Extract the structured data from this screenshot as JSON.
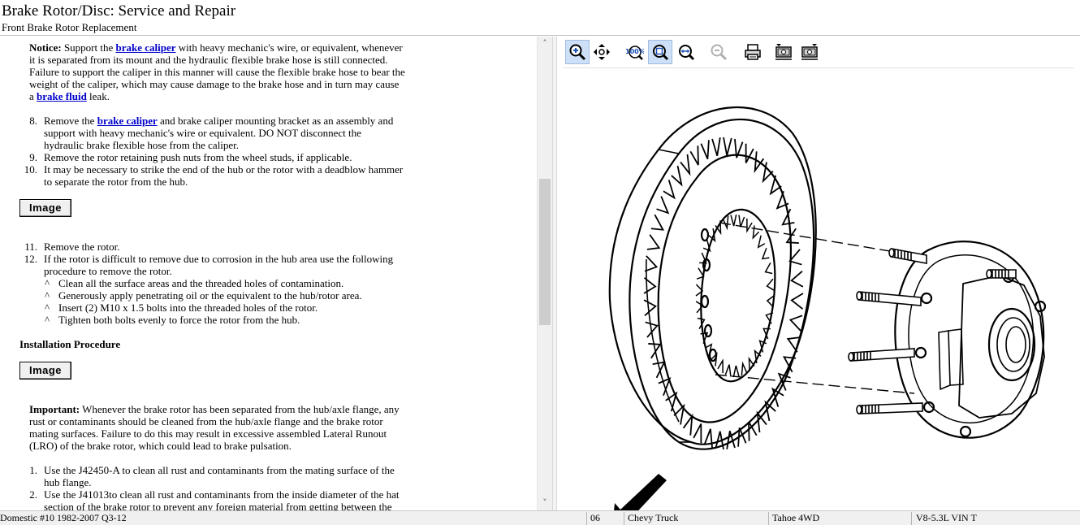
{
  "header": {
    "title": "Brake Rotor/Disc:  Service and Repair",
    "subtitle": "Front Brake Rotor Replacement"
  },
  "content": {
    "notice": {
      "label": "Notice:",
      "line1_pre": " Support the ",
      "line1_link": "brake caliper",
      "line1_post": " with heavy mechanic's wire, or equivalent, whenever",
      "line2": "it is separated from its mount and the hydraulic flexible brake hose is still connected.",
      "line3": "Failure to support the caliper in this manner will cause the flexible brake hose to bear the",
      "line4": "weight of the caliper, which may cause damage to the brake hose and in turn may cause",
      "line5_pre": "a ",
      "line5_link": "brake fluid",
      "line5_post": " leak."
    },
    "steps_a": [
      {
        "num": "8.",
        "l1_pre": "Remove the ",
        "l1_link": "brake caliper",
        "l1_post": " and brake caliper mounting bracket as an assembly and",
        "l2": "support with heavy mechanic's wire or equivalent. DO NOT disconnect the",
        "l3": "hydraulic brake flexible hose from the caliper."
      },
      {
        "num": "9.",
        "l1": "Remove the rotor retaining push nuts from the wheel studs, if applicable."
      },
      {
        "num": "10.",
        "l1": "It may be necessary to strike the end of the hub or the rotor with a deadblow hammer",
        "l2": "to separate the rotor from the hub."
      }
    ],
    "image_button_label": "Image",
    "steps_b": [
      {
        "num": "11.",
        "l1": "Remove the rotor."
      },
      {
        "num": "12.",
        "l1": "If the rotor is difficult to remove due to corrosion in the hub area use the following",
        "l2": "procedure to remove the rotor."
      }
    ],
    "substeps": [
      {
        "bullet": "^",
        "text": "Clean all the surface areas and the threaded holes of contamination."
      },
      {
        "bullet": "^",
        "text": "Generously apply penetrating oil or the equivalent to the hub/rotor area."
      },
      {
        "bullet": "^",
        "text": "Insert (2) M10 x 1.5 bolts into the threaded holes of the rotor."
      },
      {
        "bullet": "^",
        "text": "Tighten both bolts evenly to force the rotor from the hub."
      }
    ],
    "installation_heading": "Installation Procedure",
    "important": {
      "label": "Important:",
      "line1": " Whenever the brake rotor has been separated from the hub/axle flange, any",
      "line2": "rust or contaminants should be cleaned from the hub/axle flange and the brake rotor",
      "line3": "mating surfaces. Failure to do this may result in excessive assembled Lateral Runout",
      "line4": "(LRO) of the brake rotor, which could lead to brake pulsation."
    },
    "steps_c": [
      {
        "num": "1.",
        "l1": "Use the J42450-A to clean all rust and contaminants from the mating surface of the",
        "l2": "hub flange."
      },
      {
        "num": "2.",
        "l1": "Use the J41013to clean all rust and contaminants from the inside diameter of the hat",
        "l2": "section of the brake rotor to prevent any foreign material from getting between the"
      }
    ]
  },
  "scrollbar": {
    "up_icon": "chevron-up-icon",
    "down_icon": "chevron-down-icon",
    "up_glyph": "˄",
    "down_glyph": "˅"
  },
  "toolbar": {
    "buttons": [
      {
        "name": "zoom-in-icon",
        "active": true
      },
      {
        "name": "pan-move-icon",
        "active": false
      },
      {
        "name": "zoom-100-icon",
        "active": false
      },
      {
        "name": "zoom-fit-icon",
        "active": true
      },
      {
        "name": "zoom-width-icon",
        "active": false
      },
      {
        "name": "zoom-out-icon",
        "active": false,
        "disabled": true
      },
      {
        "name": "print-icon",
        "active": false
      },
      {
        "name": "rotate-left-icon",
        "active": false
      },
      {
        "name": "rotate-right-icon",
        "active": false
      }
    ],
    "zoom100_label": "100%"
  },
  "status": {
    "left": "Domestic #10 1982-2007 Q3-12",
    "year": "06",
    "make": "Chevy Truck",
    "model": "Tahoe 4WD",
    "engine": "V8-5.3L VIN T"
  }
}
